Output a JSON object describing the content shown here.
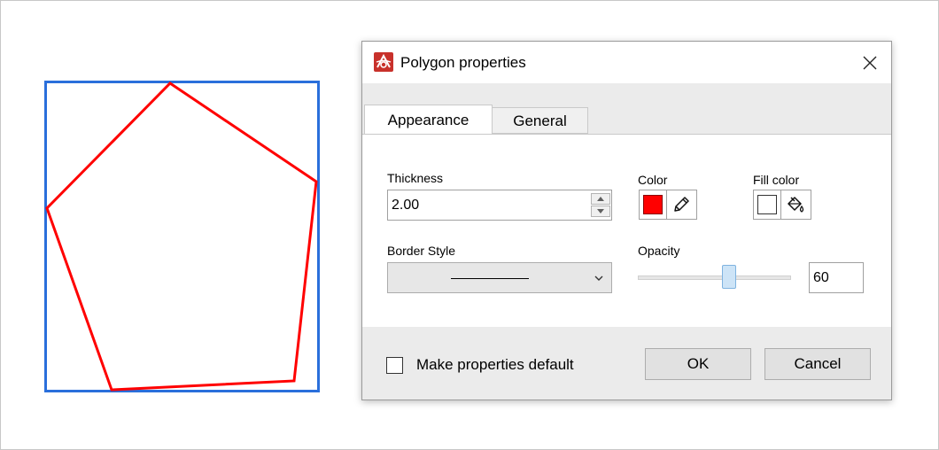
{
  "dialog": {
    "title": "Polygon properties",
    "icon": "pdf-app-icon",
    "close_icon": "close-icon"
  },
  "tabs": [
    {
      "label": "Appearance",
      "active": true
    },
    {
      "label": "General",
      "active": false
    }
  ],
  "appearance": {
    "thickness_label": "Thickness",
    "thickness_value": "2.00",
    "color_label": "Color",
    "color_value": "#ff0000",
    "fill_color_label": "Fill color",
    "fill_color_value": "#ffffff",
    "border_style_label": "Border Style",
    "border_style_value": "solid",
    "opacity_label": "Opacity",
    "opacity_value": "60",
    "opacity_slider_fraction": 0.6
  },
  "footer": {
    "default_checkbox_label": "Make properties default",
    "default_checked": false,
    "ok_label": "OK",
    "cancel_label": "Cancel"
  },
  "canvas": {
    "polygon_stroke_color": "#ff0000",
    "selection_color": "#2a6fdb"
  }
}
